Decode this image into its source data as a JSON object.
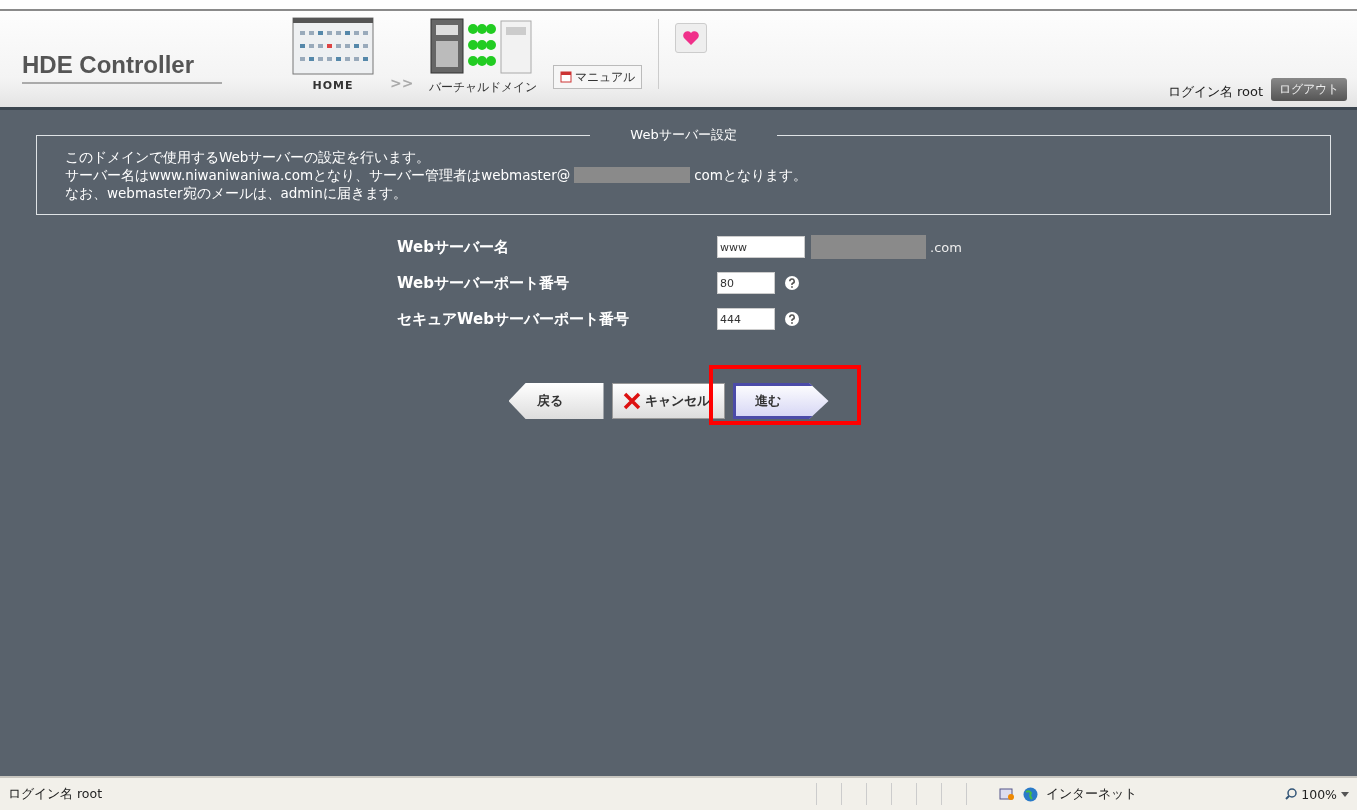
{
  "header": {
    "logo": "HDE Controller",
    "nav": [
      {
        "kind": "home",
        "label": "HOME"
      },
      {
        "kind": "separator",
        "label": ">>"
      },
      {
        "kind": "domain",
        "label": "バーチャルドメイン"
      }
    ],
    "manual_button": "マニュアル",
    "login": "ログイン名 root",
    "logout_button": "ログアウト"
  },
  "section": {
    "legend": "Webサーバー設定",
    "lines": [
      [
        {
          "kind": "text",
          "text": "このドメインで使用するWebサーバーの設定を行います。"
        }
      ],
      [
        {
          "kind": "text",
          "text": "サーバー名はwww.niwaniwaniwa.comとなり、サーバー管理者はwebmaster@"
        },
        {
          "kind": "redacted"
        },
        {
          "kind": "text",
          "text": "comとなります。"
        }
      ],
      [
        {
          "kind": "text",
          "text": "なお、webmaster宛のメールは、adminに届きます。"
        }
      ]
    ]
  },
  "form": [
    {
      "label": "Webサーバー名",
      "value": "www",
      "wide": true,
      "redacted_suffix": true,
      "suffix": ".com",
      "help": false
    },
    {
      "label": "Webサーバーポート番号",
      "value": "80",
      "wide": false,
      "redacted_suffix": false,
      "help": true
    },
    {
      "label": "セキュアWebサーバーポート番号",
      "value": "444",
      "wide": false,
      "redacted_suffix": false,
      "help": true
    }
  ],
  "buttons": [
    {
      "kind": "back",
      "label": "戻る",
      "highlighted": false
    },
    {
      "kind": "cancel",
      "label": "キャンセル",
      "highlighted": false
    },
    {
      "kind": "next",
      "label": "進む",
      "highlighted": true
    }
  ],
  "status_bar": {
    "left": "ログイン名 root",
    "zone": "インターネット",
    "zoom": "100%"
  }
}
